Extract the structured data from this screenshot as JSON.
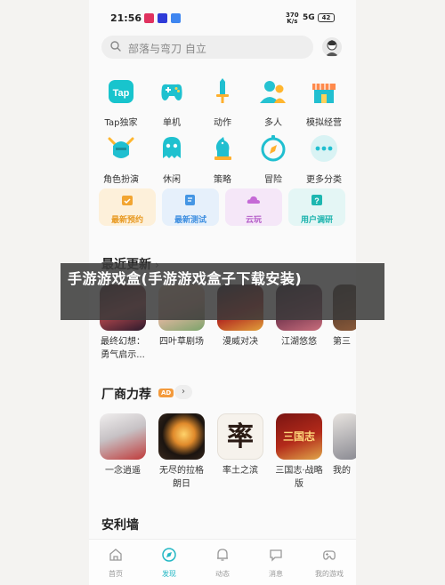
{
  "status_bar": {
    "time": "21:56",
    "rate_top": "370",
    "rate_bottom": "K/s",
    "signal": "5G",
    "battery": "42"
  },
  "search": {
    "placeholder": "部落与弯刀 自立"
  },
  "categories": [
    {
      "label": "Tap独家",
      "icon": "tap-icon"
    },
    {
      "label": "单机",
      "icon": "gamepad-icon"
    },
    {
      "label": "动作",
      "icon": "sword-icon"
    },
    {
      "label": "多人",
      "icon": "people-icon"
    },
    {
      "label": "模拟经营",
      "icon": "shop-icon"
    },
    {
      "label": "角色扮演",
      "icon": "helmet-icon"
    },
    {
      "label": "休闲",
      "icon": "ghost-icon"
    },
    {
      "label": "策略",
      "icon": "chess-knight-icon"
    },
    {
      "label": "冒险",
      "icon": "compass-icon"
    },
    {
      "label": "更多分类",
      "icon": "more-icon"
    }
  ],
  "cards": [
    {
      "label": "最新预约",
      "icon": "calendar-check-icon",
      "bg": "#fdf0da",
      "fg": "#e89a23"
    },
    {
      "label": "最新测试",
      "icon": "edit-icon",
      "bg": "#e6f0fb",
      "fg": "#3d8ee0"
    },
    {
      "label": "云玩",
      "icon": "cloud-icon",
      "bg": "#f5e7f8",
      "fg": "#b45cc8"
    },
    {
      "label": "用户调研",
      "icon": "question-icon",
      "bg": "#e4f6f5",
      "fg": "#1bb3ad"
    }
  ],
  "recent": {
    "title": "最近更新",
    "chevron": "›",
    "apps": [
      {
        "name": "最终幻想：勇气启示...",
        "tile_text": "FFVII"
      },
      {
        "name": "四叶草剧场",
        "tile_text": ""
      },
      {
        "name": "漫威对决",
        "tile_text": "MARVEL"
      },
      {
        "name": "江湖悠悠",
        "tile_text": "江湖悠悠"
      },
      {
        "name": "第三",
        "tile_text": ""
      }
    ]
  },
  "vendor": {
    "title": "厂商力荐",
    "ad_badge": "AD",
    "chevron": "›",
    "apps": [
      {
        "name": "一念逍遥",
        "tile_text": ""
      },
      {
        "name": "无尽的拉格朗日",
        "tile_text": ""
      },
      {
        "name": "率土之滨",
        "tile_text": "率"
      },
      {
        "name": "三国志·战略版",
        "tile_text": "三国志"
      },
      {
        "name": "我的",
        "tile_text": ""
      }
    ]
  },
  "anliqiang": {
    "title": "安利墙"
  },
  "banner": {
    "text": "手游游戏盒(手游游戏盒子下载安装)"
  },
  "tabs": [
    {
      "label": "首页",
      "icon": "home-icon",
      "active": false
    },
    {
      "label": "发现",
      "icon": "discover-icon",
      "active": true
    },
    {
      "label": "动态",
      "icon": "bell-icon",
      "active": false
    },
    {
      "label": "消息",
      "icon": "message-icon",
      "active": false
    },
    {
      "label": "我的游戏",
      "icon": "controller-icon",
      "active": false
    }
  ],
  "colors": {
    "accent": "#22b7c4",
    "tap_teal": "#15c5ce"
  }
}
